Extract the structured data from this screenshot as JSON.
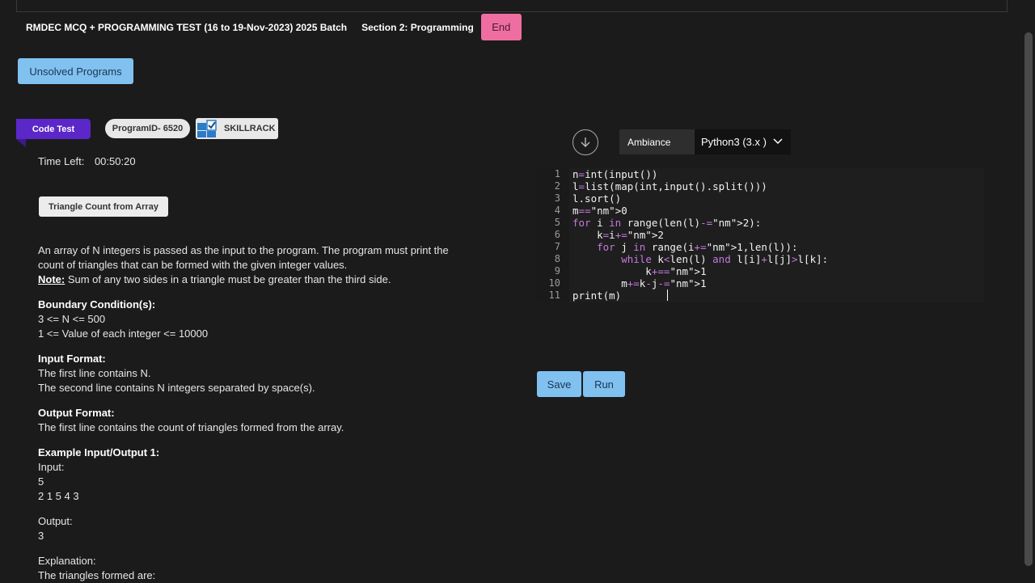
{
  "header": {
    "title": "RMDEC MCQ + PROGRAMMING TEST (16 to 19-Nov-2023) 2025 Batch",
    "section": "Section 2: Programming",
    "end_label": "End"
  },
  "unsolved_label": "Unsolved Programs",
  "badges": {
    "code_test": "Code Test",
    "program_id": "ProgramID- 6520",
    "skillrack": "SKILLRACK"
  },
  "time": {
    "label": "Time Left:",
    "value": "00:50:20"
  },
  "problem": {
    "title": "Triangle Count from Array",
    "desc_line1": "An array of N integers is passed as the input to the program. The program must print the",
    "desc_line2": "count of triangles that can be formed with the given integer values.",
    "note_label": "Note:",
    "note_text": " Sum of any two sides in a triangle must be greater than the third side.",
    "boundary_heading": "Boundary Condition(s):",
    "boundary_1": "3 <= N <= 500",
    "boundary_2": "1 <= Value of each integer <= 10000",
    "input_heading": "Input Format:",
    "input_1": "The first line contains N.",
    "input_2": "The second line contains N integers separated by space(s).",
    "output_heading": "Output Format:",
    "output_1": "The first line contains the count of triangles formed from the array.",
    "example_heading": "Example Input/Output 1:",
    "ex_input_label": "Input:",
    "ex_input_1": "5",
    "ex_input_2": "2 1 5 4 3",
    "ex_output_label": "Output:",
    "ex_output_1": "3",
    "explanation_label": "Explanation:",
    "explanation_1": "The triangles formed are:"
  },
  "editor": {
    "ambiance_label": "Ambiance",
    "language": "Python3 (3.x )",
    "lines": [
      {
        "n": "1",
        "code": "n=int(input())"
      },
      {
        "n": "2",
        "code": "l=list(map(int,input().split()))"
      },
      {
        "n": "3",
        "code": "l.sort()"
      },
      {
        "n": "4",
        "code": "m=0"
      },
      {
        "n": "5",
        "code": "for i in range(len(l)-2):"
      },
      {
        "n": "6",
        "code": "    k=i+2"
      },
      {
        "n": "7",
        "code": "    for j in range(i+1,len(l)):"
      },
      {
        "n": "8",
        "code": "        while k<len(l) and l[i]+l[j]>l[k]:"
      },
      {
        "n": "9",
        "code": "            k+=1"
      },
      {
        "n": "10",
        "code": "        m+=k-j-1"
      },
      {
        "n": "11",
        "code": "print(m)"
      }
    ]
  },
  "actions": {
    "save_label": "Save",
    "run_label": "Run"
  },
  "colors": {
    "end_button": "#ee6ea1",
    "primary_button": "#80c1f0",
    "code_test_badge": "#5b27c9"
  }
}
